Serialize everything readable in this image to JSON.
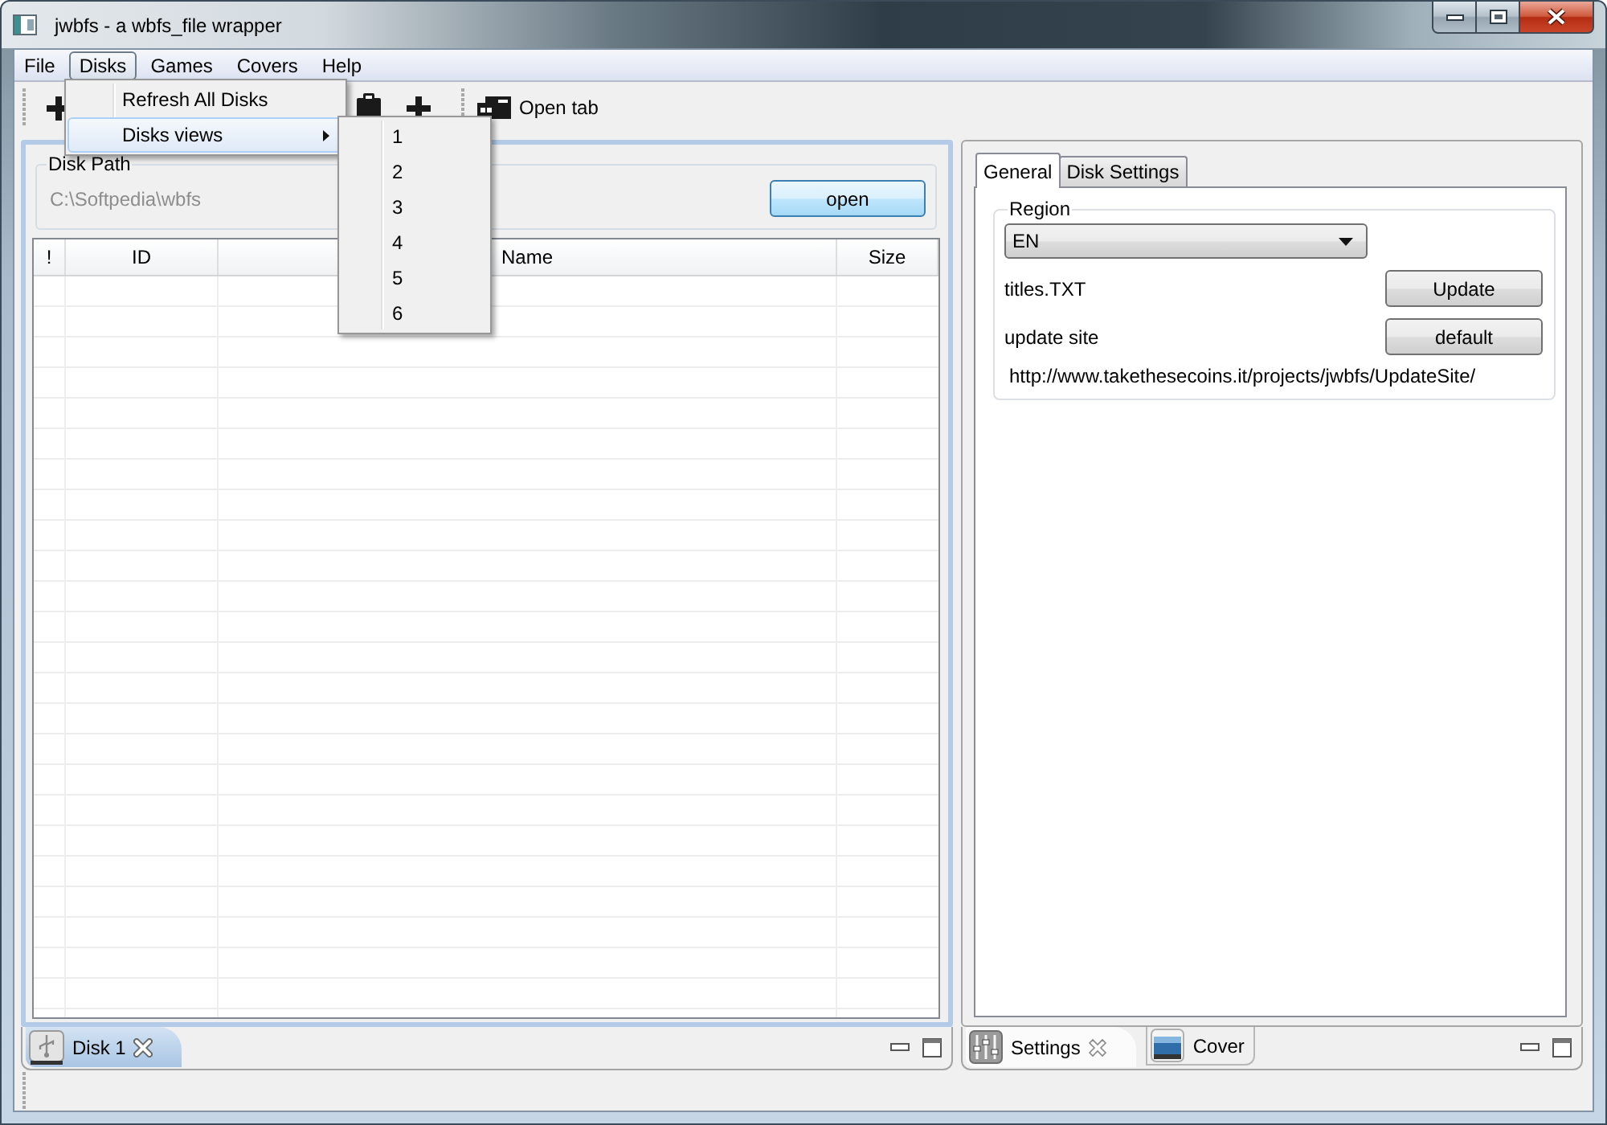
{
  "window": {
    "title": "jwbfs - a wbfs_file wrapper"
  },
  "menu_bar": [
    {
      "label": "File",
      "selected": false
    },
    {
      "label": "Disks",
      "selected": true
    },
    {
      "label": "Games",
      "selected": false
    },
    {
      "label": "Covers",
      "selected": false
    },
    {
      "label": "Help",
      "selected": false
    }
  ],
  "open_menu": {
    "items": [
      {
        "label": "Refresh All Disks",
        "kind": "action",
        "selected": false
      },
      {
        "label": "Disks views",
        "kind": "submenu",
        "selected": true
      }
    ],
    "submenu": [
      "1",
      "2",
      "3",
      "4",
      "5",
      "6"
    ]
  },
  "toolbar": {
    "open_tab_label": "Open tab"
  },
  "disk_view": {
    "active": true,
    "disk_path": {
      "label": "Disk Path",
      "path": "C:\\Softpedia\\wbfs",
      "button": "open"
    },
    "table": {
      "columns": [
        "!",
        "ID",
        "Name",
        "Size"
      ]
    },
    "tabs": [
      {
        "label": "Disk 1",
        "selected": true
      }
    ]
  },
  "settings_view": {
    "active": false,
    "tabs": [
      {
        "label": "General",
        "selected": true
      },
      {
        "label": "Disk Settings",
        "selected": false
      }
    ],
    "region": {
      "label": "Region",
      "value": "EN"
    },
    "rows": [
      {
        "label": "titles.TXT",
        "button": "Update"
      },
      {
        "label": "update site",
        "button": "default"
      }
    ],
    "url": "http://www.takethesecoins.it/projects/jwbfs/UpdateSite/",
    "view_tabs": [
      {
        "label": "Settings",
        "selected": true,
        "kind": "settings"
      },
      {
        "label": "Cover",
        "selected": false,
        "kind": "cover"
      }
    ]
  }
}
